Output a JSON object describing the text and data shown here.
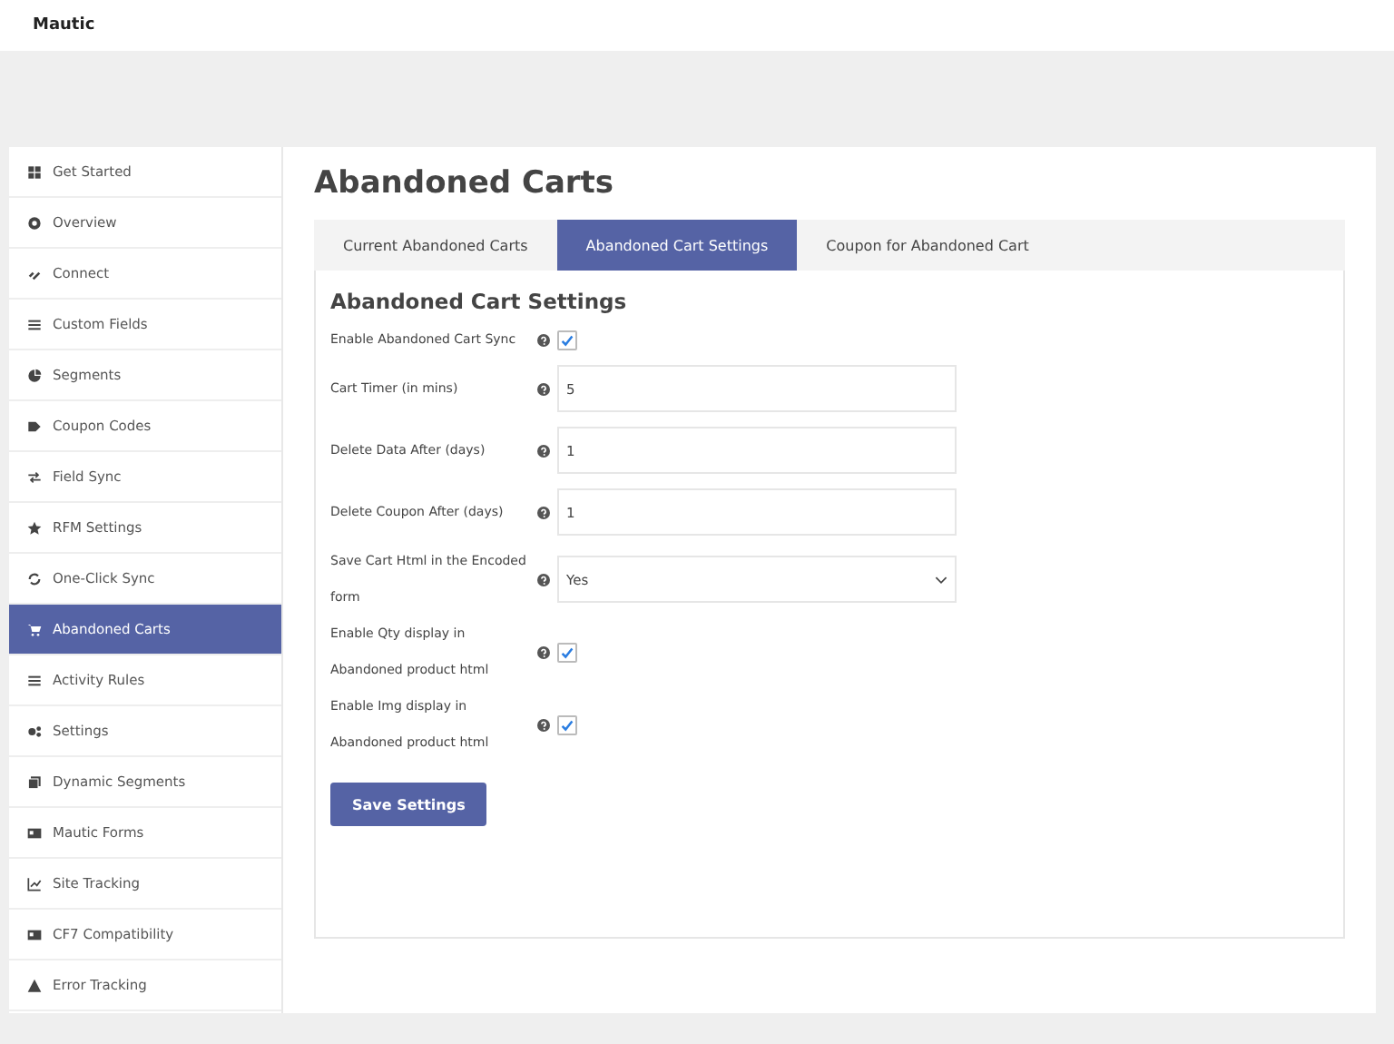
{
  "app_bar": {
    "title": "Mautic"
  },
  "sidebar": {
    "items": [
      {
        "label": "Get Started",
        "selected": false
      },
      {
        "label": "Overview",
        "selected": false
      },
      {
        "label": "Connect",
        "selected": false
      },
      {
        "label": "Custom Fields",
        "selected": false
      },
      {
        "label": "Segments",
        "selected": false
      },
      {
        "label": "Coupon Codes",
        "selected": false
      },
      {
        "label": "Field Sync",
        "selected": false
      },
      {
        "label": "RFM Settings",
        "selected": false
      },
      {
        "label": "One-Click Sync",
        "selected": false
      },
      {
        "label": "Abandoned Carts",
        "selected": true
      },
      {
        "label": "Activity Rules",
        "selected": false
      },
      {
        "label": "Settings",
        "selected": false
      },
      {
        "label": "Dynamic Segments",
        "selected": false
      },
      {
        "label": "Mautic Forms",
        "selected": false
      },
      {
        "label": "Site Tracking",
        "selected": false
      },
      {
        "label": "CF7 Compatibility",
        "selected": false
      },
      {
        "label": "Error Tracking",
        "selected": false
      }
    ]
  },
  "page": {
    "title": "Abandoned Carts"
  },
  "tabs": [
    {
      "label": "Current Abandoned Carts",
      "selected": false
    },
    {
      "label": "Abandoned Cart Settings",
      "selected": true
    },
    {
      "label": "Coupon for Abandoned Cart",
      "selected": false
    }
  ],
  "form": {
    "heading": "Abandoned Cart Settings",
    "fields": [
      {
        "kind": "checkbox",
        "label": "Enable Abandoned Cart Sync",
        "checked": true
      },
      {
        "kind": "text",
        "label": "Cart Timer (in mins)",
        "value": "5"
      },
      {
        "kind": "text",
        "label": "Delete Data After (days)",
        "value": "1"
      },
      {
        "kind": "text",
        "label": "Delete Coupon After (days)",
        "value": "1"
      },
      {
        "kind": "select",
        "label": "Save Cart Html in the Encoded form",
        "value": "Yes"
      },
      {
        "kind": "checkbox",
        "label": "Enable Qty display in Abandoned product html",
        "checked": true
      },
      {
        "kind": "checkbox",
        "label": "Enable Img display in Abandoned product html",
        "checked": true
      }
    ],
    "save_button": "Save Settings"
  }
}
